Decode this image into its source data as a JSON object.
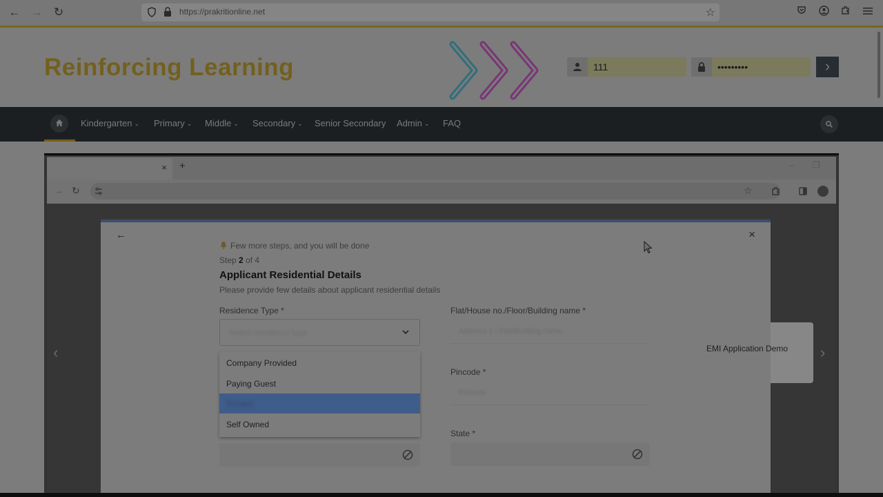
{
  "browser": {
    "url": "https://prakritionline.net",
    "nav": {
      "back": "←",
      "forward": "→",
      "reload": "↻",
      "star": "☆"
    },
    "toolbar_icons": [
      "pocket-icon",
      "account-icon",
      "extensions-icon",
      "menu-icon"
    ]
  },
  "site": {
    "title": "Reinforcing Learning",
    "login": {
      "username_value": "111",
      "password_value": "•••••••••",
      "go_label": "›"
    },
    "nav": [
      {
        "label": "Kindergarten",
        "dropdown": true
      },
      {
        "label": "Primary",
        "dropdown": true
      },
      {
        "label": "Middle",
        "dropdown": true
      },
      {
        "label": "Secondary",
        "dropdown": true
      },
      {
        "label": "Senior Secondary",
        "dropdown": false
      },
      {
        "label": "Admin",
        "dropdown": true
      },
      {
        "label": "FAQ",
        "dropdown": false
      }
    ],
    "chevron": "⌄"
  },
  "embed": {
    "tab_close": "×",
    "new_tab": "+",
    "win_min": "–",
    "win_restore": "❐",
    "modal": {
      "back": "←",
      "close": "×",
      "step_hint": "Few more steps, and you will be done",
      "step_prefix": "Step ",
      "step_current": "2",
      "step_suffix": " of 4",
      "title": "Applicant Residential Details",
      "subtitle": "Please provide few details about applicant residential details",
      "residence_label": "Residence Type *",
      "residence_placeholder": "Select residence type",
      "flat_label": "Flat/House no./Floor/Building name *",
      "flat_placeholder": "Address 1 / Flat/Building name",
      "pincode_label": "Pincode *",
      "pincode_placeholder": "Pincode",
      "state_label": "State *",
      "dropdown_options": [
        "Company Provided",
        "Paying Guest",
        "Rented",
        "Self Owned"
      ],
      "selected_index": 2
    },
    "side_card_label": "EMI Application Demo",
    "carousel_prev": "‹",
    "carousel_next": "›"
  },
  "colors": {
    "brand_gold": "#73601e",
    "nav_bg": "#1c1f21",
    "selected_option": "#3f5d8a"
  }
}
